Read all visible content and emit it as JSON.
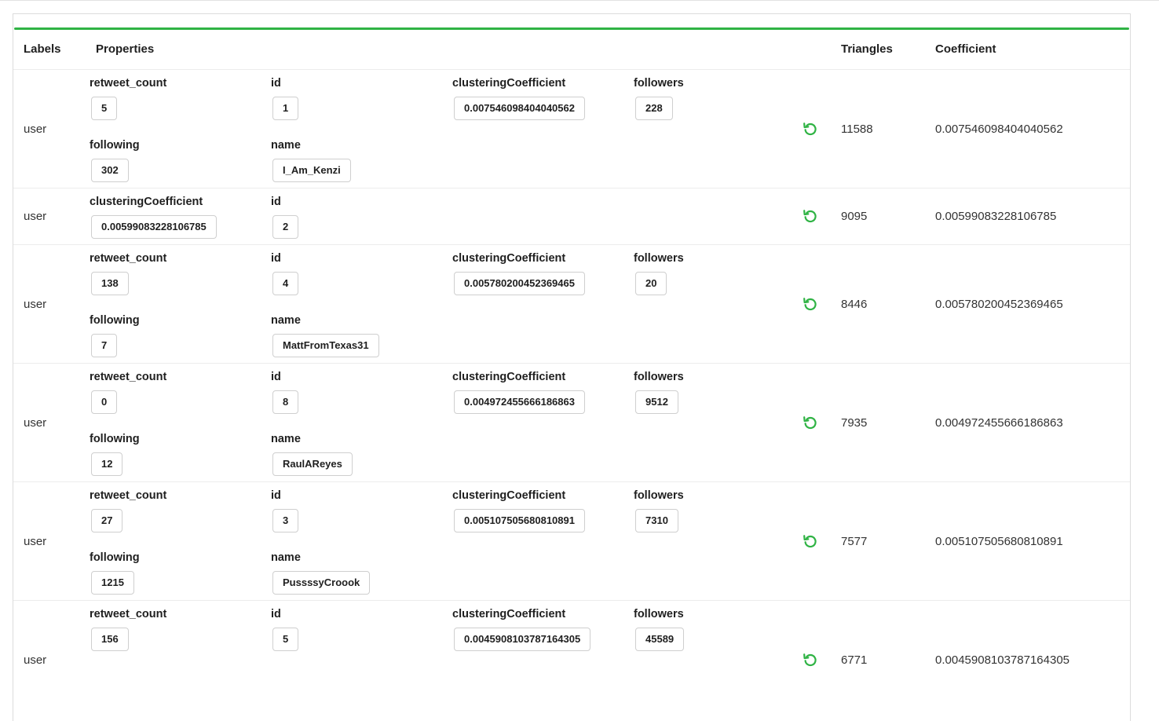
{
  "table": {
    "columns": {
      "labels": "Labels",
      "properties": "Properties",
      "triangles": "Triangles",
      "coefficient": "Coefficient"
    },
    "accent_color": "#2fb344",
    "rows": [
      {
        "label": "user",
        "triangles": "11588",
        "coefficient": "0.007546098404040562",
        "props": {
          "retweet_count": {
            "key": "retweet_count",
            "value": "5"
          },
          "id": {
            "key": "id",
            "value": "1"
          },
          "clusteringCoefficient": {
            "key": "clusteringCoefficient",
            "value": "0.007546098404040562"
          },
          "followers": {
            "key": "followers",
            "value": "228"
          },
          "following": {
            "key": "following",
            "value": "302"
          },
          "name": {
            "key": "name",
            "value": "I_Am_Kenzi"
          }
        }
      },
      {
        "label": "user",
        "triangles": "9095",
        "coefficient": "0.00599083228106785",
        "props": {
          "clusteringCoefficient": {
            "key": "clusteringCoefficient",
            "value": "0.00599083228106785"
          },
          "id": {
            "key": "id",
            "value": "2"
          }
        }
      },
      {
        "label": "user",
        "triangles": "8446",
        "coefficient": "0.005780200452369465",
        "props": {
          "retweet_count": {
            "key": "retweet_count",
            "value": "138"
          },
          "id": {
            "key": "id",
            "value": "4"
          },
          "clusteringCoefficient": {
            "key": "clusteringCoefficient",
            "value": "0.005780200452369465"
          },
          "followers": {
            "key": "followers",
            "value": "20"
          },
          "following": {
            "key": "following",
            "value": "7"
          },
          "name": {
            "key": "name",
            "value": "MattFromTexas31"
          }
        }
      },
      {
        "label": "user",
        "triangles": "7935",
        "coefficient": "0.004972455666186863",
        "props": {
          "retweet_count": {
            "key": "retweet_count",
            "value": "0"
          },
          "id": {
            "key": "id",
            "value": "8"
          },
          "clusteringCoefficient": {
            "key": "clusteringCoefficient",
            "value": "0.004972455666186863"
          },
          "followers": {
            "key": "followers",
            "value": "9512"
          },
          "following": {
            "key": "following",
            "value": "12"
          },
          "name": {
            "key": "name",
            "value": "RaulAReyes"
          }
        }
      },
      {
        "label": "user",
        "triangles": "7577",
        "coefficient": "0.005107505680810891",
        "props": {
          "retweet_count": {
            "key": "retweet_count",
            "value": "27"
          },
          "id": {
            "key": "id",
            "value": "3"
          },
          "clusteringCoefficient": {
            "key": "clusteringCoefficient",
            "value": "0.005107505680810891"
          },
          "followers": {
            "key": "followers",
            "value": "7310"
          },
          "following": {
            "key": "following",
            "value": "1215"
          },
          "name": {
            "key": "name",
            "value": "PussssyCroook"
          }
        }
      },
      {
        "label": "user",
        "triangles": "6771",
        "coefficient": "0.0045908103787164305",
        "props": {
          "retweet_count": {
            "key": "retweet_count",
            "value": "156"
          },
          "id": {
            "key": "id",
            "value": "5"
          },
          "clusteringCoefficient": {
            "key": "clusteringCoefficient",
            "value": "0.0045908103787164305"
          },
          "followers": {
            "key": "followers",
            "value": "45589"
          }
        }
      }
    ]
  },
  "icons": {
    "reset": "reset-icon"
  }
}
